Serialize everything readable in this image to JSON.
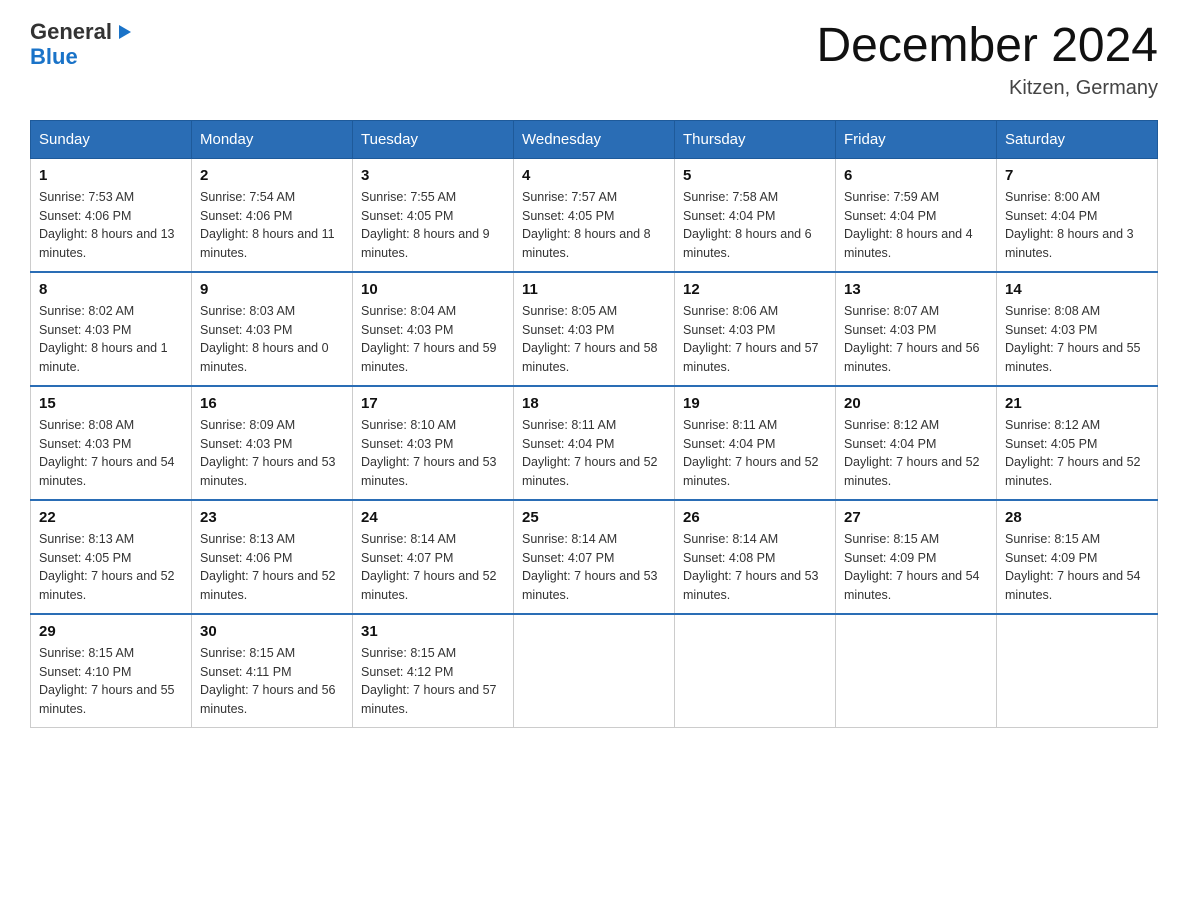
{
  "header": {
    "logo_general": "General",
    "logo_blue": "Blue",
    "main_title": "December 2024",
    "subtitle": "Kitzen, Germany"
  },
  "days_of_week": [
    "Sunday",
    "Monday",
    "Tuesday",
    "Wednesday",
    "Thursday",
    "Friday",
    "Saturday"
  ],
  "weeks": [
    [
      {
        "day": "1",
        "sunrise": "Sunrise: 7:53 AM",
        "sunset": "Sunset: 4:06 PM",
        "daylight": "Daylight: 8 hours and 13 minutes."
      },
      {
        "day": "2",
        "sunrise": "Sunrise: 7:54 AM",
        "sunset": "Sunset: 4:06 PM",
        "daylight": "Daylight: 8 hours and 11 minutes."
      },
      {
        "day": "3",
        "sunrise": "Sunrise: 7:55 AM",
        "sunset": "Sunset: 4:05 PM",
        "daylight": "Daylight: 8 hours and 9 minutes."
      },
      {
        "day": "4",
        "sunrise": "Sunrise: 7:57 AM",
        "sunset": "Sunset: 4:05 PM",
        "daylight": "Daylight: 8 hours and 8 minutes."
      },
      {
        "day": "5",
        "sunrise": "Sunrise: 7:58 AM",
        "sunset": "Sunset: 4:04 PM",
        "daylight": "Daylight: 8 hours and 6 minutes."
      },
      {
        "day": "6",
        "sunrise": "Sunrise: 7:59 AM",
        "sunset": "Sunset: 4:04 PM",
        "daylight": "Daylight: 8 hours and 4 minutes."
      },
      {
        "day": "7",
        "sunrise": "Sunrise: 8:00 AM",
        "sunset": "Sunset: 4:04 PM",
        "daylight": "Daylight: 8 hours and 3 minutes."
      }
    ],
    [
      {
        "day": "8",
        "sunrise": "Sunrise: 8:02 AM",
        "sunset": "Sunset: 4:03 PM",
        "daylight": "Daylight: 8 hours and 1 minute."
      },
      {
        "day": "9",
        "sunrise": "Sunrise: 8:03 AM",
        "sunset": "Sunset: 4:03 PM",
        "daylight": "Daylight: 8 hours and 0 minutes."
      },
      {
        "day": "10",
        "sunrise": "Sunrise: 8:04 AM",
        "sunset": "Sunset: 4:03 PM",
        "daylight": "Daylight: 7 hours and 59 minutes."
      },
      {
        "day": "11",
        "sunrise": "Sunrise: 8:05 AM",
        "sunset": "Sunset: 4:03 PM",
        "daylight": "Daylight: 7 hours and 58 minutes."
      },
      {
        "day": "12",
        "sunrise": "Sunrise: 8:06 AM",
        "sunset": "Sunset: 4:03 PM",
        "daylight": "Daylight: 7 hours and 57 minutes."
      },
      {
        "day": "13",
        "sunrise": "Sunrise: 8:07 AM",
        "sunset": "Sunset: 4:03 PM",
        "daylight": "Daylight: 7 hours and 56 minutes."
      },
      {
        "day": "14",
        "sunrise": "Sunrise: 8:08 AM",
        "sunset": "Sunset: 4:03 PM",
        "daylight": "Daylight: 7 hours and 55 minutes."
      }
    ],
    [
      {
        "day": "15",
        "sunrise": "Sunrise: 8:08 AM",
        "sunset": "Sunset: 4:03 PM",
        "daylight": "Daylight: 7 hours and 54 minutes."
      },
      {
        "day": "16",
        "sunrise": "Sunrise: 8:09 AM",
        "sunset": "Sunset: 4:03 PM",
        "daylight": "Daylight: 7 hours and 53 minutes."
      },
      {
        "day": "17",
        "sunrise": "Sunrise: 8:10 AM",
        "sunset": "Sunset: 4:03 PM",
        "daylight": "Daylight: 7 hours and 53 minutes."
      },
      {
        "day": "18",
        "sunrise": "Sunrise: 8:11 AM",
        "sunset": "Sunset: 4:04 PM",
        "daylight": "Daylight: 7 hours and 52 minutes."
      },
      {
        "day": "19",
        "sunrise": "Sunrise: 8:11 AM",
        "sunset": "Sunset: 4:04 PM",
        "daylight": "Daylight: 7 hours and 52 minutes."
      },
      {
        "day": "20",
        "sunrise": "Sunrise: 8:12 AM",
        "sunset": "Sunset: 4:04 PM",
        "daylight": "Daylight: 7 hours and 52 minutes."
      },
      {
        "day": "21",
        "sunrise": "Sunrise: 8:12 AM",
        "sunset": "Sunset: 4:05 PM",
        "daylight": "Daylight: 7 hours and 52 minutes."
      }
    ],
    [
      {
        "day": "22",
        "sunrise": "Sunrise: 8:13 AM",
        "sunset": "Sunset: 4:05 PM",
        "daylight": "Daylight: 7 hours and 52 minutes."
      },
      {
        "day": "23",
        "sunrise": "Sunrise: 8:13 AM",
        "sunset": "Sunset: 4:06 PM",
        "daylight": "Daylight: 7 hours and 52 minutes."
      },
      {
        "day": "24",
        "sunrise": "Sunrise: 8:14 AM",
        "sunset": "Sunset: 4:07 PM",
        "daylight": "Daylight: 7 hours and 52 minutes."
      },
      {
        "day": "25",
        "sunrise": "Sunrise: 8:14 AM",
        "sunset": "Sunset: 4:07 PM",
        "daylight": "Daylight: 7 hours and 53 minutes."
      },
      {
        "day": "26",
        "sunrise": "Sunrise: 8:14 AM",
        "sunset": "Sunset: 4:08 PM",
        "daylight": "Daylight: 7 hours and 53 minutes."
      },
      {
        "day": "27",
        "sunrise": "Sunrise: 8:15 AM",
        "sunset": "Sunset: 4:09 PM",
        "daylight": "Daylight: 7 hours and 54 minutes."
      },
      {
        "day": "28",
        "sunrise": "Sunrise: 8:15 AM",
        "sunset": "Sunset: 4:09 PM",
        "daylight": "Daylight: 7 hours and 54 minutes."
      }
    ],
    [
      {
        "day": "29",
        "sunrise": "Sunrise: 8:15 AM",
        "sunset": "Sunset: 4:10 PM",
        "daylight": "Daylight: 7 hours and 55 minutes."
      },
      {
        "day": "30",
        "sunrise": "Sunrise: 8:15 AM",
        "sunset": "Sunset: 4:11 PM",
        "daylight": "Daylight: 7 hours and 56 minutes."
      },
      {
        "day": "31",
        "sunrise": "Sunrise: 8:15 AM",
        "sunset": "Sunset: 4:12 PM",
        "daylight": "Daylight: 7 hours and 57 minutes."
      },
      null,
      null,
      null,
      null
    ]
  ]
}
